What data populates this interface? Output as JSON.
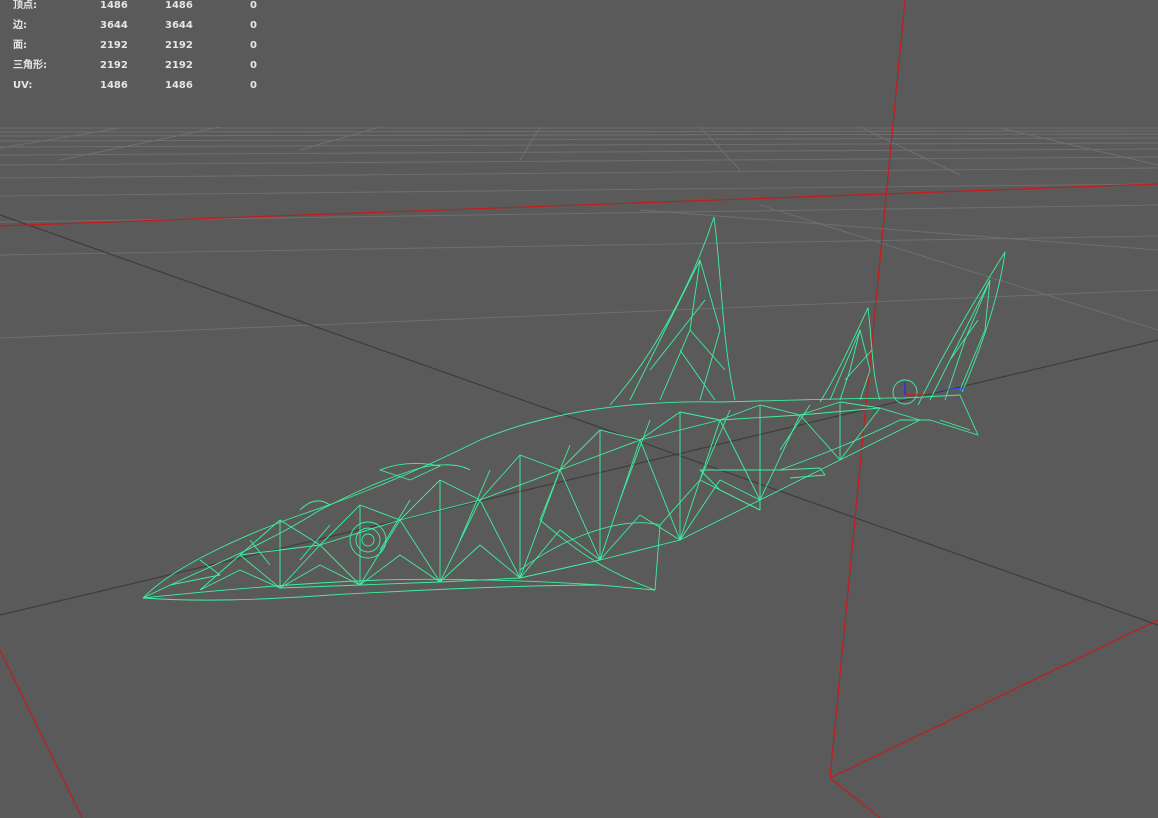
{
  "hud": {
    "rows": [
      {
        "label": "顶点:",
        "v1": "1486",
        "v2": "1486",
        "v3": "0"
      },
      {
        "label": "边:",
        "v1": "3644",
        "v2": "3644",
        "v3": "0"
      },
      {
        "label": "面:",
        "v1": "2192",
        "v2": "2192",
        "v3": "0"
      },
      {
        "label": "三角形:",
        "v1": "2192",
        "v2": "2192",
        "v3": "0"
      },
      {
        "label": "UV:",
        "v1": "1486",
        "v2": "1486",
        "v3": "0"
      }
    ]
  },
  "colors": {
    "background": "#5a5a5a",
    "grid": "#6e6e6e",
    "axis_dark": "#3c3c3c",
    "axis_red": "#c02020",
    "wireframe": "#3cf0a0",
    "hud_text": "#e6e6e6"
  }
}
